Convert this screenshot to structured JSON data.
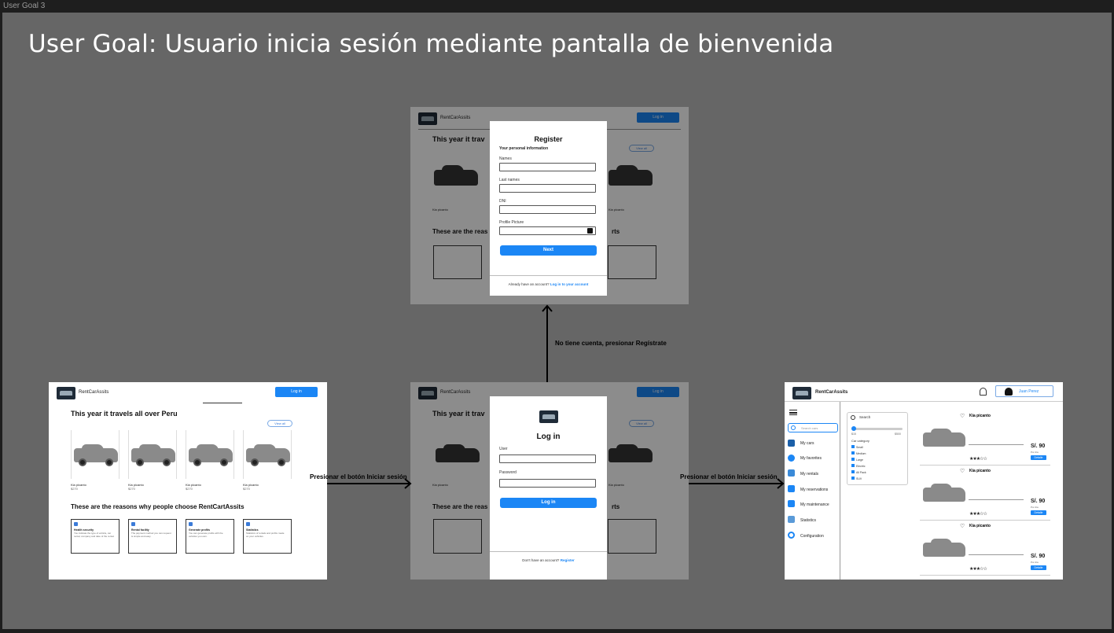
{
  "frame": {
    "name": "User Goal 3"
  },
  "goal_title": "User Goal: Usuario inicia sesión mediante pantalla de bienvenida",
  "landing": {
    "brand": "RentCarAssits",
    "login_button": "Log in",
    "heading": "This year it travels all over Peru",
    "view_all": "View all",
    "cars": [
      {
        "name": "Kia picanto",
        "price": "$270"
      },
      {
        "name": "Kia picanto",
        "price": "$270"
      },
      {
        "name": "Kia picanto",
        "price": "$270"
      },
      {
        "name": "Kia picanto",
        "price": "$270"
      }
    ],
    "reasons_heading": "These are the reasons why people choose RentCartAssits",
    "reasons": [
      {
        "title": "Health security",
        "text": "You indicate the type of vehicle, car rental, company and date of the rental."
      },
      {
        "title": "Rental facility",
        "text": "The payment method you can request is simple and easy."
      },
      {
        "title": "Generate profits",
        "text": "You can generate profits with the vehicles you own."
      },
      {
        "title": "Statistics",
        "text": "Statistics of rentals and profits made on your vehicles."
      }
    ]
  },
  "login_screen": {
    "brand": "RentCarAssits",
    "header_button": "Log in",
    "heading_partial": "This year it trav",
    "view_all": "View all",
    "reasons_partial": "These are the reas",
    "reasons_tail": "rts",
    "modal": {
      "title": "Log in",
      "user_label": "User",
      "password_label": "Password",
      "submit": "Log in",
      "footer_text": "Don't have an account?",
      "footer_link": "Register"
    }
  },
  "register_screen": {
    "brand": "RentCarAssits",
    "header_button": "Log in",
    "heading_partial": "This year it trav",
    "view_all": "View all",
    "reasons_partial": "These are the reas",
    "reasons_tail": "rts",
    "modal": {
      "title": "Register",
      "subtitle": "Your personal information",
      "fields": [
        "Names",
        "Last names",
        "DNI",
        "Profile Picture"
      ],
      "submit": "Next",
      "footer_text": "Already have an account?",
      "footer_link": "Log in to your account"
    }
  },
  "dashboard": {
    "brand": "RentCarAssits",
    "user_name": "Juan Perez",
    "search_placeholder": "Search cars",
    "nav": [
      "My cars",
      "My favorites",
      "My rentals",
      "My reservations",
      "My maintenance",
      "Statistics",
      "Configuration"
    ],
    "filter": {
      "search_label": "Search",
      "range_min": "$15",
      "range_max": "$500",
      "category_title": "Car category",
      "categories": [
        "Small",
        "Medium",
        "Large",
        "Electric",
        "All Pack",
        "SUV"
      ]
    },
    "listings": [
      {
        "name": "Kia picanto",
        "price": "S/. 90",
        "per": "Por día",
        "rating": "★★★☆☆",
        "button": "Detalle"
      },
      {
        "name": "Kia picanto",
        "price": "S/. 90",
        "per": "Por día",
        "rating": "★★★☆☆",
        "button": "Detalle"
      },
      {
        "name": "Kia picanto",
        "price": "S/. 90",
        "per": "Por día",
        "rating": "★★★☆☆",
        "button": "Detalle"
      }
    ]
  },
  "flow_labels": {
    "to_register": "No tiene cuenta, presionar Regístrate",
    "landing_to_login": "Presionar el botón Iniciar sesión",
    "login_to_dashboard": "Presionar el botón Iniciar sesión"
  },
  "colors": {
    "accent": "#1b86f5",
    "canvas": "#666666",
    "background": "#1e1e1e"
  }
}
